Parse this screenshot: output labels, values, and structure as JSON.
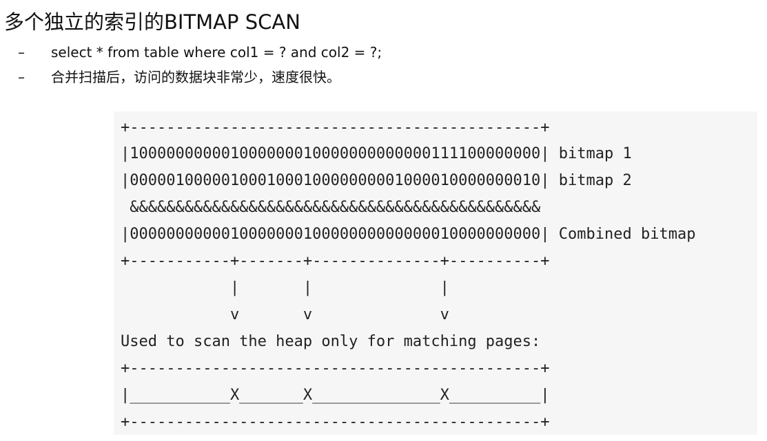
{
  "title": "多个独立的索引的BITMAP SCAN",
  "bullets": [
    {
      "marker": "–",
      "text": "select * from table where col1 = ? and col2 = ?;"
    },
    {
      "marker": "–",
      "text": "合并扫描后，访问的数据块非常少，速度很快。"
    }
  ],
  "diagram": {
    "lines": [
      "+---------------------------------------------+",
      "|100000000001000000010000000000000111100000000| bitmap 1",
      "|000001000001000100010000000001000010000000010| bitmap 2",
      " &&&&&&&&&&&&&&&&&&&&&&&&&&&&&&&&&&&&&&&&&&&&&",
      "|000000000001000000010000000000000010000000000| Combined bitmap",
      "+-----------+-------+--------------+----------+",
      "            |       |              |",
      "            v       v              v",
      "Used to scan the heap only for matching pages:",
      "+---------------------------------------------+",
      "|___________X_______X______________X__________|",
      "+---------------------------------------------+"
    ]
  }
}
